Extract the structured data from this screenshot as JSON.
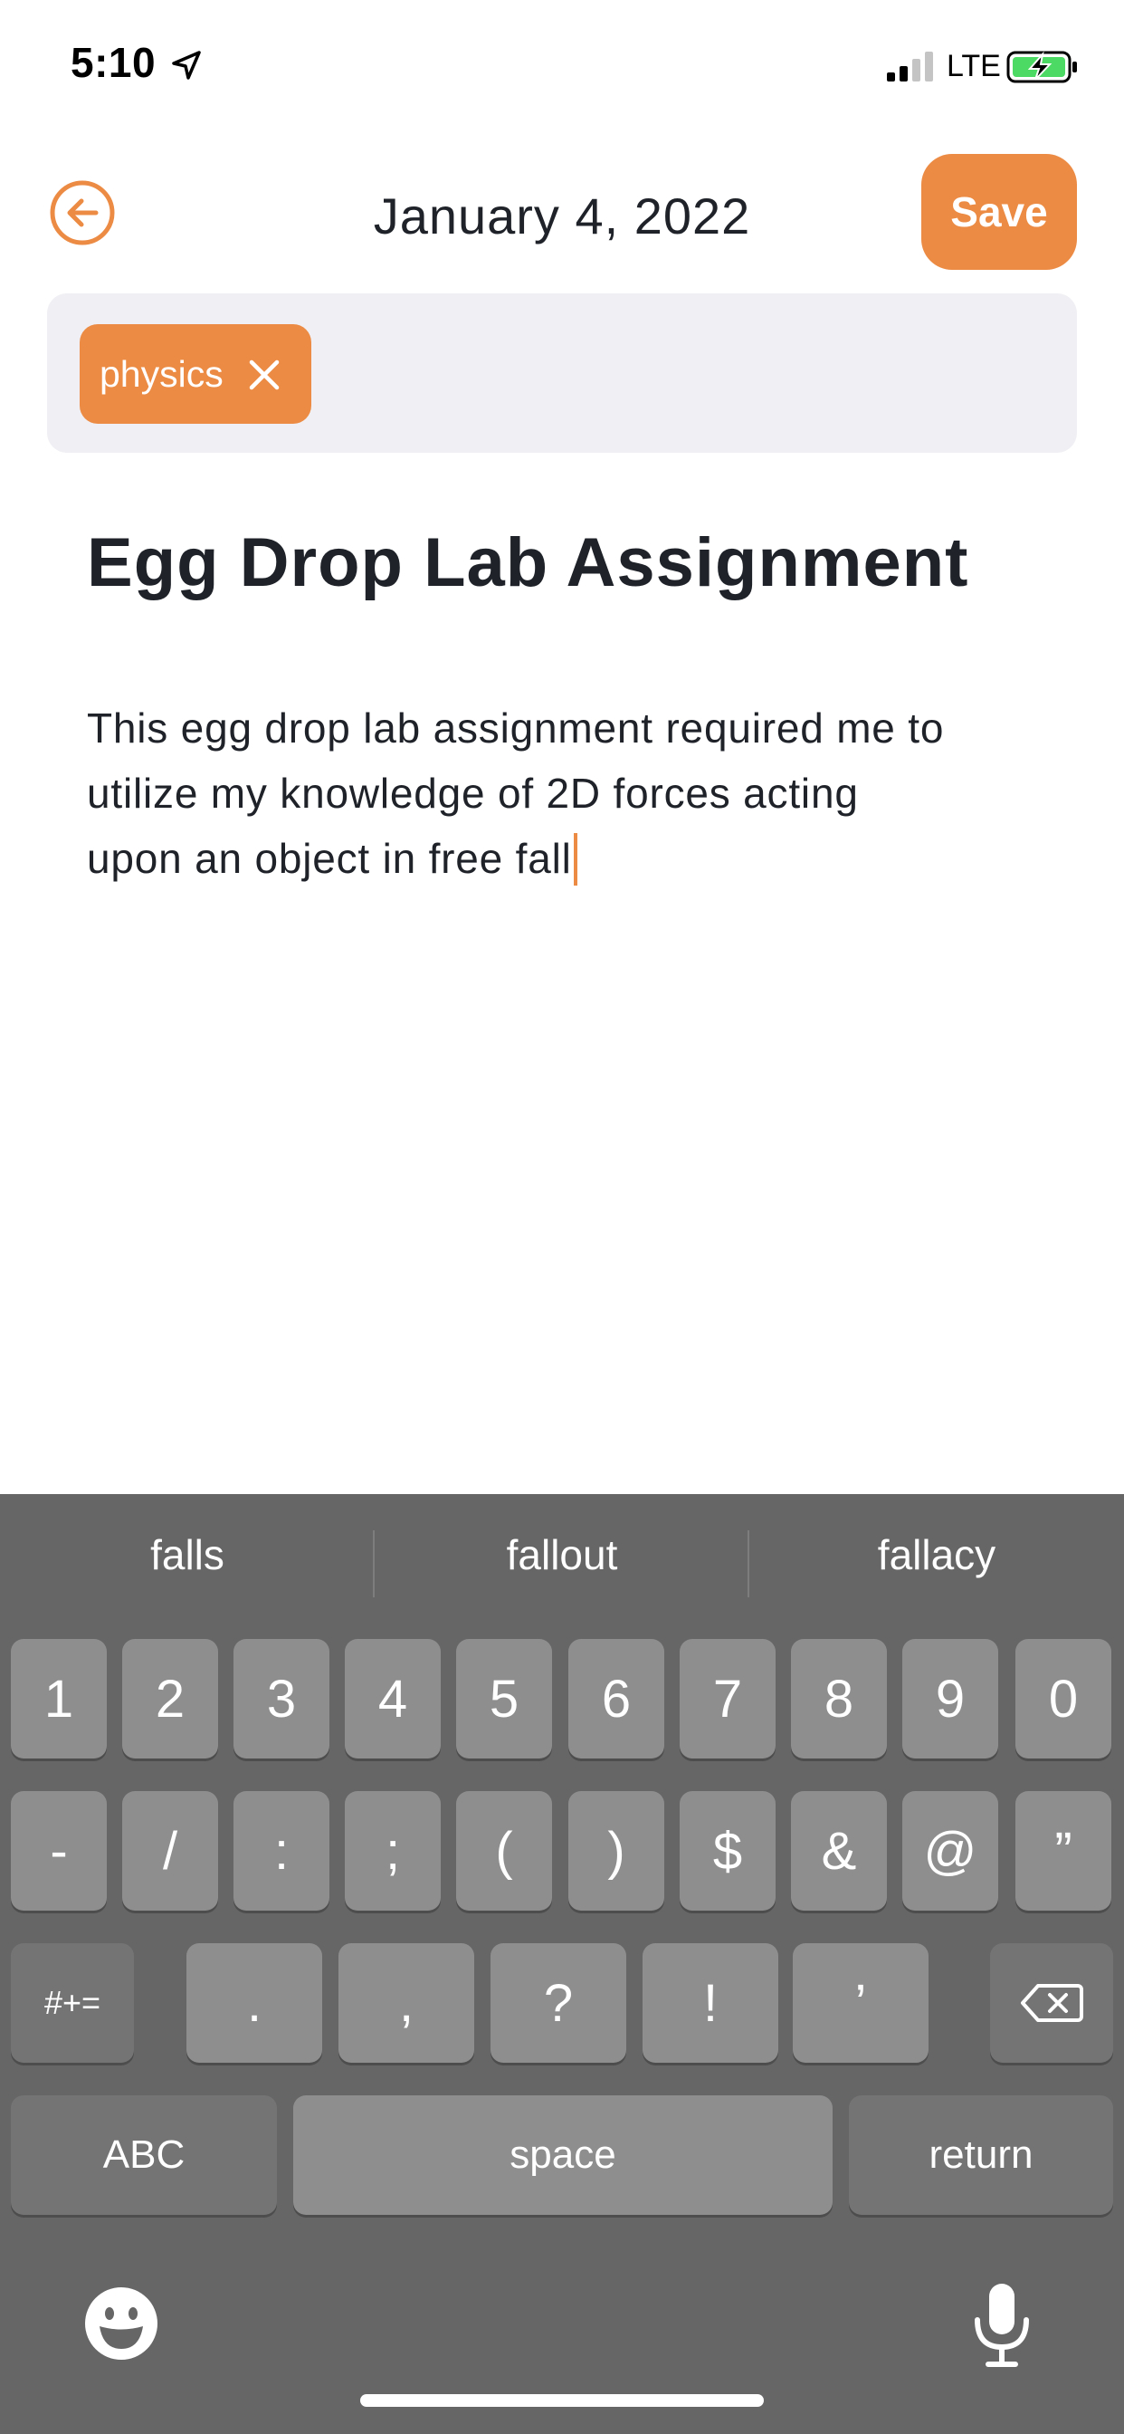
{
  "status_bar": {
    "time": "5:10",
    "network": "LTE",
    "icons": [
      "location-arrow-icon",
      "cellular-signal-icon",
      "battery-charging-icon"
    ]
  },
  "header": {
    "back_icon": "back-arrow-circle-icon",
    "date": "January 4, 2022",
    "save_label": "Save"
  },
  "tags": [
    {
      "label": "physics",
      "remove_icon": "close-icon"
    }
  ],
  "note": {
    "title": "Egg Drop Lab Assignment",
    "body_lines": [
      "This egg drop lab assignment required me to",
      "utilize my knowledge of 2D forces acting",
      "upon an object in free fall"
    ]
  },
  "keyboard": {
    "suggestions": [
      "falls",
      "fallout",
      "fallacy"
    ],
    "row1": [
      "1",
      "2",
      "3",
      "4",
      "5",
      "6",
      "7",
      "8",
      "9",
      "0"
    ],
    "row2": [
      "-",
      "/",
      ":",
      ";",
      "(",
      ")",
      "$",
      "&",
      "@",
      "”"
    ],
    "row3_left": "#+=",
    "row3_keys": [
      ".",
      ",",
      "?",
      "!",
      "’"
    ],
    "row3_right_icon": "backspace-icon",
    "abc_label": "ABC",
    "space_label": "space",
    "return_label": "return",
    "emoji_icon": "emoji-icon",
    "mic_icon": "microphone-icon"
  },
  "colors": {
    "accent": "#ec8b44",
    "keyboard_bg": "#666667",
    "key_bg": "#8e8e8f",
    "tag_area_bg": "#f0f0f4"
  }
}
